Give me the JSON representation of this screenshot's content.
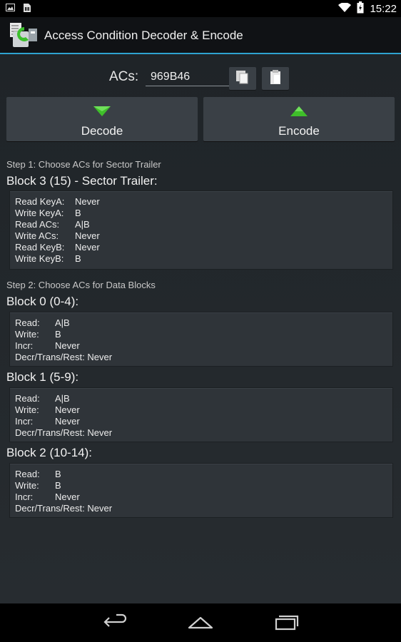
{
  "status": {
    "time": "15:22"
  },
  "app": {
    "title": "Access Condition Decoder & Encode"
  },
  "acs": {
    "label": "ACs:",
    "value": "969B46"
  },
  "buttons": {
    "decode": "Decode",
    "encode": "Encode"
  },
  "step1": "Step 1: Choose ACs for Sector Trailer",
  "step2": "Step 2: Choose ACs for Data Blocks",
  "trailer": {
    "title": "Block 3 (15) - Sector Trailer:",
    "rows": [
      {
        "k": "Read KeyA:",
        "v": "Never"
      },
      {
        "k": "Write KeyA:",
        "v": "B"
      },
      {
        "k": "Read ACs:",
        "v": "A|B"
      },
      {
        "k": "Write ACs:",
        "v": "Never"
      },
      {
        "k": "Read KeyB:",
        "v": "Never"
      },
      {
        "k": "Write KeyB:",
        "v": "B"
      }
    ]
  },
  "blocks": [
    {
      "title": "Block 0 (0-4):",
      "rows": [
        {
          "k": "Read:",
          "v": "A|B"
        },
        {
          "k": "Write:",
          "v": "B"
        },
        {
          "k": "Incr:",
          "v": "Never"
        },
        {
          "k": "Decr/Trans/Rest:",
          "v": "Never"
        }
      ]
    },
    {
      "title": "Block 1 (5-9):",
      "rows": [
        {
          "k": "Read:",
          "v": "A|B"
        },
        {
          "k": "Write:",
          "v": "Never"
        },
        {
          "k": "Incr:",
          "v": "Never"
        },
        {
          "k": "Decr/Trans/Rest:",
          "v": "Never"
        }
      ]
    },
    {
      "title": "Block 2 (10-14):",
      "rows": [
        {
          "k": "Read:",
          "v": "B"
        },
        {
          "k": "Write:",
          "v": "B"
        },
        {
          "k": "Incr:",
          "v": "Never"
        },
        {
          "k": "Decr/Trans/Rest:",
          "v": "Never"
        }
      ]
    }
  ],
  "colors": {
    "accent": "#2ea3d0",
    "arrow_green": "#3fbf2a"
  },
  "icons": [
    "image-icon",
    "sim-icon",
    "wifi-icon",
    "battery-icon",
    "copy-icon",
    "paste-icon",
    "back-icon",
    "home-icon",
    "recents-icon"
  ]
}
